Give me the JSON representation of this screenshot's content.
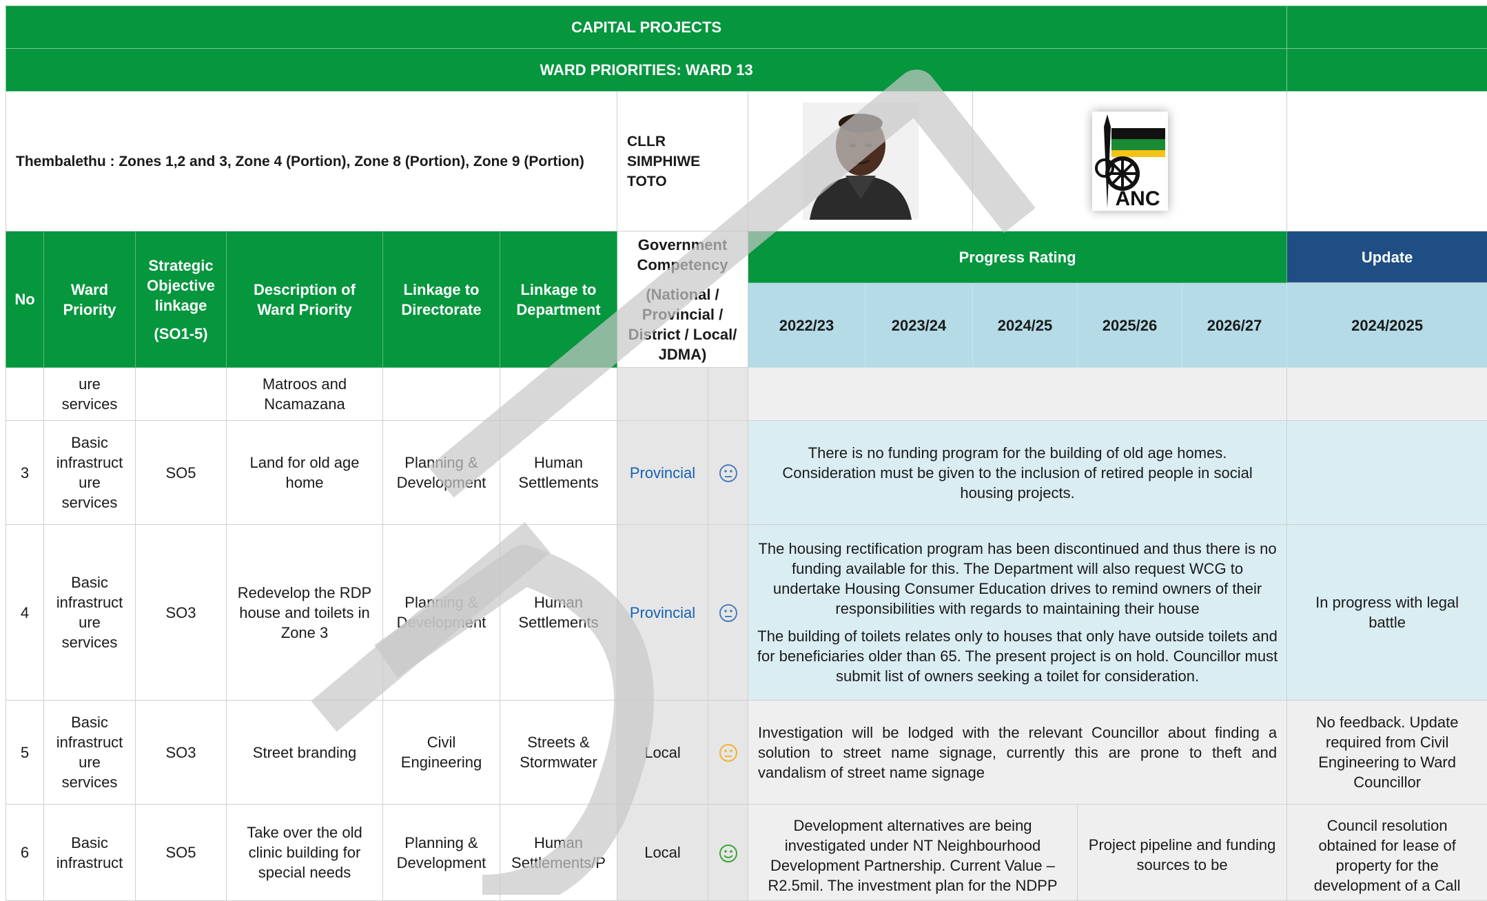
{
  "header": {
    "title": "CAPITAL PROJECTS",
    "subtitle": "WARD PRIORITIES: WARD 13"
  },
  "ward_info": {
    "area": "Thembalethu : Zones 1,2  and 3,  Zone 4 (Portion), Zone 8 (Portion), Zone 9 (Portion)",
    "councillor": "CLLR SIMPHIWE TOTO",
    "photo_icon": "councillor-portrait",
    "logo_icon": "anc-party-logo",
    "logo_text": "ANC"
  },
  "columns": {
    "no": "No",
    "ward_priority": "Ward Priority",
    "strategic_objective": "Strategic Objective linkage",
    "strategic_objective_sub": "(SO1-5)",
    "description": "Description of Ward Priority",
    "directorate": "Linkage to Directorate",
    "department": "Linkage to Department",
    "gov_competency": "Government Competency",
    "gov_competency_sub": "(National / Provincial / District / Local/ JDMA)",
    "progress_rating": "Progress Rating",
    "years": [
      "2022/23",
      "2023/24",
      "2024/25",
      "2025/26",
      "2026/27"
    ],
    "update": "Update",
    "update_year": "2024/2025"
  },
  "rows": [
    {
      "priority": "ure services",
      "description": "Matroos and Ncamazana"
    },
    {
      "no": "3",
      "priority": "Basic infrastruct ure services",
      "so": "SO5",
      "description": "Land for old age home",
      "directorate": "Planning & Development",
      "department": "Human Settlements",
      "competency": "Provincial",
      "status_icon": "neutral-face-icon",
      "progress": "There is no funding program for the building of old age homes. Consideration must be given to the inclusion of retired people in social housing projects.",
      "update": ""
    },
    {
      "no": "4",
      "priority": "Basic infrastruct ure services",
      "so": "SO3",
      "description": "Redevelop the RDP house and toilets in Zone 3",
      "directorate": "Planning & Development",
      "department": "Human Settlements",
      "competency": "Provincial",
      "status_icon": "neutral-face-icon",
      "progress_p1": "The housing rectification program has been discontinued and thus there is no funding available for this. The Department will also request WCG to undertake Housing Consumer Education drives to remind owners of their responsibilities with regards to maintaining their house",
      "progress_p2": "The building of toilets relates only to houses that only have outside toilets and for beneficiaries older than 65. The present project is on hold. Councillor must submit list of owners seeking a toilet for consideration.",
      "update": "In progress with legal battle"
    },
    {
      "no": "5",
      "priority": "Basic infrastruct ure services",
      "so": "SO3",
      "description": "Street branding",
      "directorate": "Civil Engineering",
      "department": "Streets & Stormwater",
      "competency": "Local",
      "status_icon": "neutral-face-icon",
      "progress": "Investigation will be lodged with the relevant Councillor about finding a solution to street name signage, currently this are prone to theft and vandalism of street name signage",
      "update": "No feedback. Update required from Civil Engineering to Ward Councillor"
    },
    {
      "no": "6",
      "priority": "Basic infrastruct",
      "so": "SO5",
      "description": "Take over the old clinic building for special needs",
      "directorate": "Planning & Development",
      "department": "Human Settlements/P",
      "competency": "Local",
      "status_icon": "smiley-face-icon",
      "progress_a": "Development alternatives are being investigated under NT Neighbourhood Development Partnership.  Current Value – R2.5mil.  The investment plan for the NDPP",
      "progress_b": "Project pipeline and funding sources to be",
      "update": "Council resolution obtained for lease of property for the development of a Call"
    }
  ],
  "colors": {
    "green": "#05963e",
    "navy": "#1f4e84",
    "light_blue": "#daedf3",
    "year_blue": "#b4dbe6",
    "face_blue": "#4a7ebf",
    "face_amber": "#f2b233",
    "face_green": "#3aa53a"
  },
  "watermark_icon": "draft-watermark"
}
